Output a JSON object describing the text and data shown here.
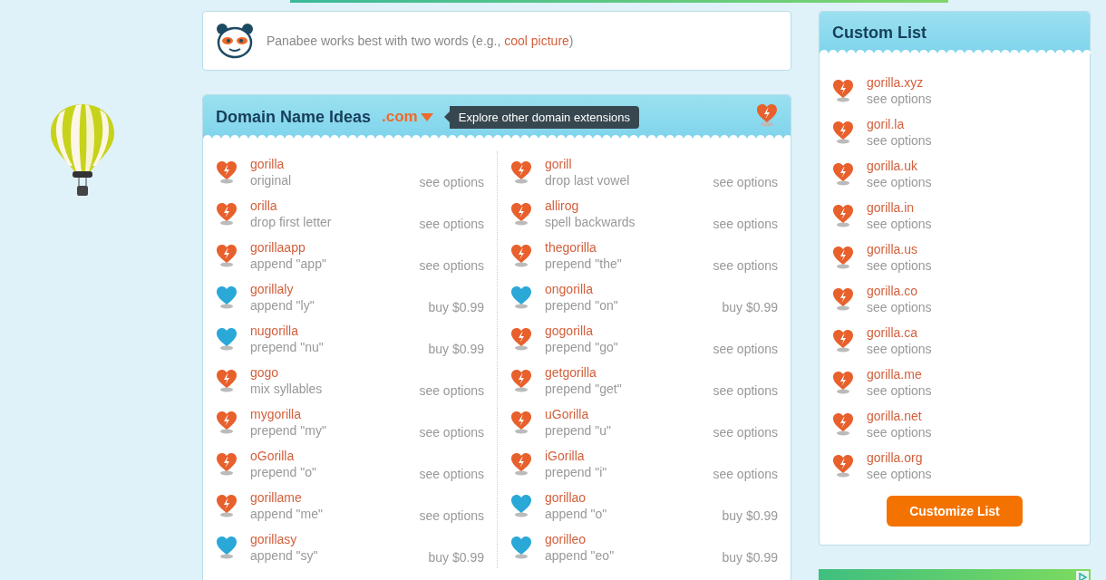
{
  "hint": {
    "before": "Panabee works best with two words (e.g., ",
    "example": "cool picture",
    "after": ")"
  },
  "ideas": {
    "title": "Domain Name Ideas",
    "extension": ".com",
    "tooltip": "Explore other domain extensions",
    "columns": [
      [
        {
          "name": "gorilla",
          "note": "original",
          "action": "see options",
          "available": false
        },
        {
          "name": "orilla",
          "note": "drop first letter",
          "action": "see options",
          "available": false
        },
        {
          "name": "gorillaapp",
          "note": "append \"app\"",
          "action": "see options",
          "available": false
        },
        {
          "name": "gorillaly",
          "note": "append \"ly\"",
          "action": "buy $0.99",
          "available": true
        },
        {
          "name": "nugorilla",
          "note": "prepend \"nu\"",
          "action": "buy $0.99",
          "available": true
        },
        {
          "name": "gogo",
          "note": "mix syllables",
          "action": "see options",
          "available": false
        },
        {
          "name": "mygorilla",
          "note": "prepend \"my\"",
          "action": "see options",
          "available": false
        },
        {
          "name": "oGorilla",
          "note": "prepend \"o\"",
          "action": "see options",
          "available": false
        },
        {
          "name": "gorillame",
          "note": "append \"me\"",
          "action": "see options",
          "available": false
        },
        {
          "name": "gorillasy",
          "note": "append \"sy\"",
          "action": "buy $0.99",
          "available": true
        }
      ],
      [
        {
          "name": "gorill",
          "note": "drop last vowel",
          "action": "see options",
          "available": false
        },
        {
          "name": "allirog",
          "note": "spell backwards",
          "action": "see options",
          "available": false
        },
        {
          "name": "thegorilla",
          "note": "prepend \"the\"",
          "action": "see options",
          "available": false
        },
        {
          "name": "ongorilla",
          "note": "prepend \"on\"",
          "action": "buy $0.99",
          "available": true
        },
        {
          "name": "gogorilla",
          "note": "prepend \"go\"",
          "action": "see options",
          "available": false
        },
        {
          "name": "getgorilla",
          "note": "prepend \"get\"",
          "action": "see options",
          "available": false
        },
        {
          "name": "uGorilla",
          "note": "prepend \"u\"",
          "action": "see options",
          "available": false
        },
        {
          "name": "iGorilla",
          "note": "prepend \"i\"",
          "action": "see options",
          "available": false
        },
        {
          "name": "gorillao",
          "note": "append \"o\"",
          "action": "buy $0.99",
          "available": true
        },
        {
          "name": "gorilleo",
          "note": "append \"eo\"",
          "action": "buy $0.99",
          "available": true
        }
      ]
    ]
  },
  "custom_list": {
    "title": "Custom List",
    "button": "Customize List",
    "items": [
      {
        "name": "gorilla.xyz",
        "action": "see options",
        "available": false
      },
      {
        "name": "goril.la",
        "action": "see options",
        "available": false
      },
      {
        "name": "gorilla.uk",
        "action": "see options",
        "available": false
      },
      {
        "name": "gorilla.in",
        "action": "see options",
        "available": false
      },
      {
        "name": "gorilla.us",
        "action": "see options",
        "available": false
      },
      {
        "name": "gorilla.co",
        "action": "see options",
        "available": false
      },
      {
        "name": "gorilla.ca",
        "action": "see options",
        "available": false
      },
      {
        "name": "gorilla.me",
        "action": "see options",
        "available": false
      },
      {
        "name": "gorilla.net",
        "action": "see options",
        "available": false
      },
      {
        "name": "gorilla.org",
        "action": "see options",
        "available": false
      }
    ]
  }
}
